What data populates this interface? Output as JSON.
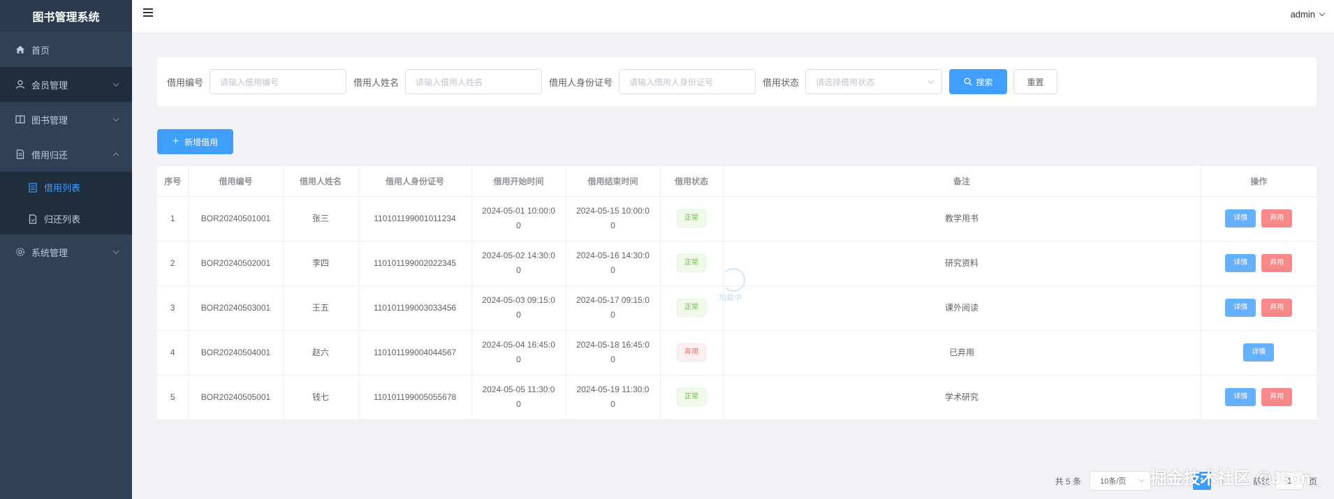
{
  "app": {
    "title": "图书管理系统"
  },
  "sidebar": {
    "items": [
      {
        "label": "首页",
        "icon": "home-icon"
      },
      {
        "label": "会员管理",
        "icon": "user-icon"
      },
      {
        "label": "图书管理",
        "icon": "book-icon"
      },
      {
        "label": "借用归还",
        "icon": "document-icon"
      },
      {
        "label": "系统管理",
        "icon": "gear-icon"
      }
    ],
    "borrow_sub": [
      {
        "label": "借用列表",
        "icon": "list-icon",
        "active": true
      },
      {
        "label": "归还列表",
        "icon": "return-doc-icon"
      }
    ]
  },
  "header": {
    "user": "admin"
  },
  "search": {
    "borrow_no_label": "借用编号",
    "borrow_no_placeholder": "请输入借用编号",
    "borrower_name_label": "借用人姓名",
    "borrower_name_placeholder": "请输入借用人姓名",
    "id_card_label": "借用人身份证号",
    "id_card_placeholder": "请输入借用人身份证号",
    "status_label": "借用状态",
    "status_placeholder": "请选择借用状态",
    "search_button": "搜索",
    "reset_button": "重置"
  },
  "toolbar": {
    "add_button": "新增借用"
  },
  "table": {
    "columns": [
      "序号",
      "借用编号",
      "借用人姓名",
      "借用人身份证号",
      "借用开始时间",
      "借用结束时间",
      "借用状态",
      "备注",
      "操作"
    ],
    "actions": {
      "detail": "详情",
      "discard": "弃用"
    },
    "rows": [
      {
        "index": "1",
        "borrow_no": "BOR20240501001",
        "name": "张三",
        "id_card": "110101199001011234",
        "start_line1": "2024-05-01 10:00:0",
        "start_line2": "0",
        "end_line1": "2024-05-15 10:00:0",
        "end_line2": "0",
        "status": "正常",
        "status_type": "ok",
        "remark": "教学用书"
      },
      {
        "index": "2",
        "borrow_no": "BOR20240502001",
        "name": "李四",
        "id_card": "110101199002022345",
        "start_line1": "2024-05-02 14:30:0",
        "start_line2": "0",
        "end_line1": "2024-05-16 14:30:0",
        "end_line2": "0",
        "status": "正常",
        "status_type": "ok",
        "remark": "研究资料"
      },
      {
        "index": "3",
        "borrow_no": "BOR20240503001",
        "name": "王五",
        "id_card": "110101199003033456",
        "start_line1": "2024-05-03 09:15:0",
        "start_line2": "0",
        "end_line1": "2024-05-17 09:15:0",
        "end_line2": "0",
        "status": "正常",
        "status_type": "ok",
        "remark": "课外阅读"
      },
      {
        "index": "4",
        "borrow_no": "BOR20240504001",
        "name": "赵六",
        "id_card": "110101199004044567",
        "start_line1": "2024-05-04 16:45:0",
        "start_line2": "0",
        "end_line1": "2024-05-18 16:45:0",
        "end_line2": "0",
        "status": "弃用",
        "status_type": "bad",
        "remark": "已弃用"
      },
      {
        "index": "5",
        "borrow_no": "BOR20240505001",
        "name": "钱七",
        "id_card": "110101199005055678",
        "start_line1": "2024-05-05 11:30:0",
        "start_line2": "0",
        "end_line1": "2024-05-19 11:30:0",
        "end_line2": "0",
        "status": "正常",
        "status_type": "ok",
        "remark": "学术研究"
      }
    ]
  },
  "loading": {
    "text": "加载中"
  },
  "pagination": {
    "total": "共 5 条",
    "page_size": "10条/页",
    "current": "1",
    "goto_prefix": "前往",
    "goto_value": "1",
    "goto_suffix": "页"
  },
  "watermark": "掘金技术社区 @Json_",
  "colors": {
    "sidebar_bg": "#304156",
    "primary": "#409eff",
    "success": "#67c23a",
    "danger": "#f56c6c"
  }
}
